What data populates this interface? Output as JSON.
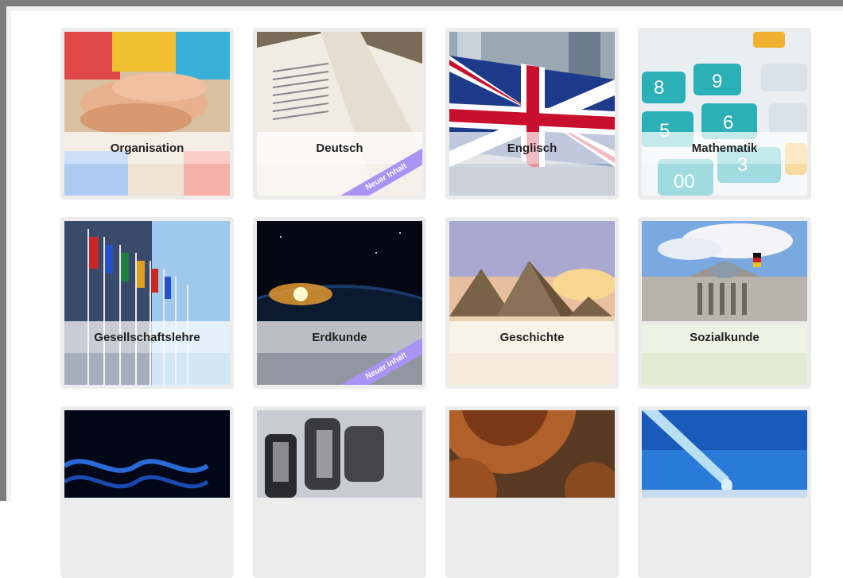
{
  "badge_label": "Neuer Inhalt",
  "colors": {
    "frame": "#7c7c7c",
    "ribbon": "#a993f4",
    "tile_bg": "#ececec"
  },
  "subjects": [
    {
      "label": "Organisation",
      "icon": "hands-together-image",
      "new": false
    },
    {
      "label": "Deutsch",
      "icon": "open-book-image",
      "new": true
    },
    {
      "label": "Englisch",
      "icon": "union-jack-flag-image",
      "new": false
    },
    {
      "label": "Mathematik",
      "icon": "calculator-keys-image",
      "new": false
    },
    {
      "label": "Gesellschaftslehre",
      "icon": "flags-building-image",
      "new": false
    },
    {
      "label": "Erdkunde",
      "icon": "earth-sunrise-image",
      "new": true
    },
    {
      "label": "Geschichte",
      "icon": "pyramids-image",
      "new": false
    },
    {
      "label": "Sozialkunde",
      "icon": "reichstag-image",
      "new": false
    },
    {
      "label": "",
      "icon": "dna-helix-image",
      "new": false
    },
    {
      "label": "",
      "icon": "microscope-image",
      "new": false
    },
    {
      "label": "",
      "icon": "rusty-gears-image",
      "new": false
    },
    {
      "label": "",
      "icon": "pipette-drop-image",
      "new": false
    }
  ]
}
